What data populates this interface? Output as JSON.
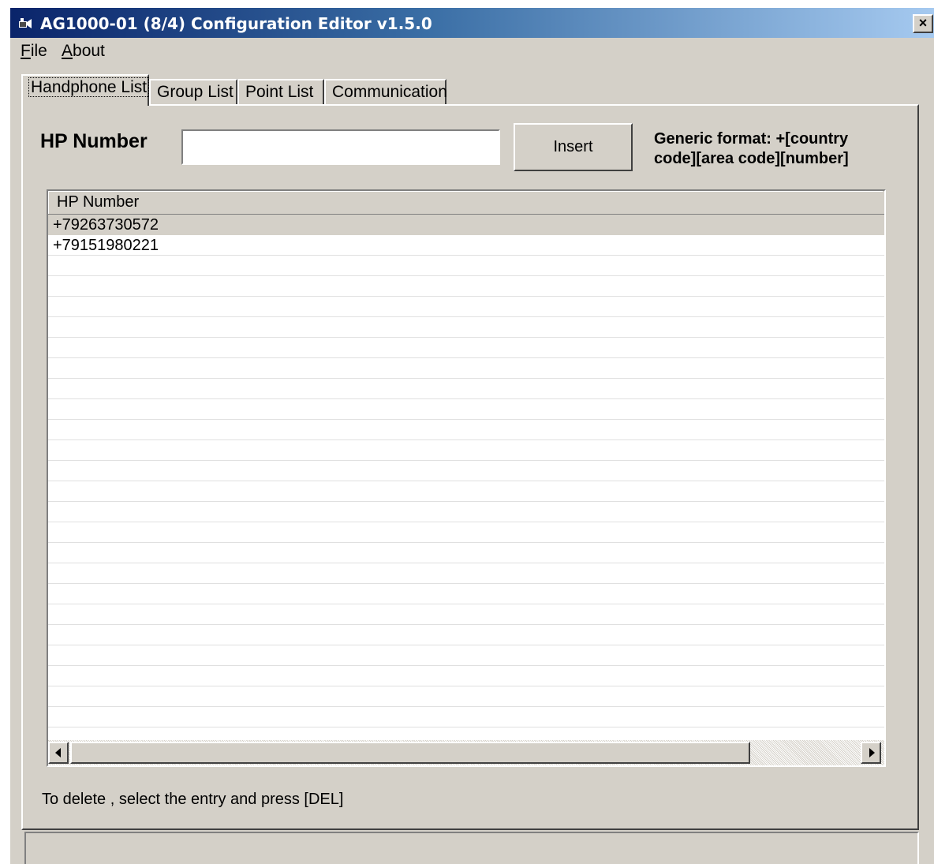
{
  "window": {
    "title": "AG1000-01 (8/4) Configuration Editor v1.5.0",
    "close_label": "×"
  },
  "menu": {
    "file": {
      "mnemonic": "F",
      "rest": "ile"
    },
    "about": {
      "mnemonic": "A",
      "rest": "bout"
    }
  },
  "tabs": [
    {
      "label": "Handphone List",
      "active": true
    },
    {
      "label": "Group List",
      "active": false
    },
    {
      "label": "Point List",
      "active": false
    },
    {
      "label": "Communication",
      "active": false
    }
  ],
  "form": {
    "hp_label": "HP Number",
    "hp_value": "",
    "insert_label": "Insert",
    "format_hint": "Generic format: +[country code][area code][number]"
  },
  "list": {
    "column_header": "HP Number",
    "rows": [
      "+79263730572",
      "+79151980221"
    ],
    "selected_index": 0
  },
  "delete_hint": "To delete , select the entry and press [DEL]",
  "status_text": ""
}
